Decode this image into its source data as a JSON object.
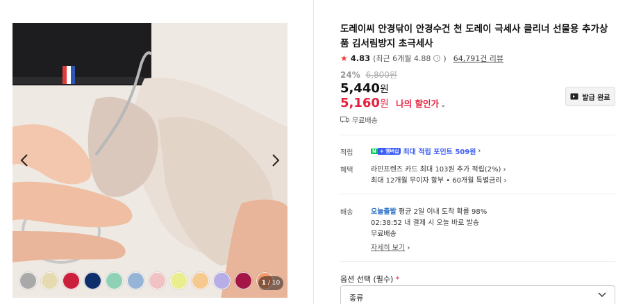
{
  "product": {
    "title": "도레이씨 안경닦이 안경수건 천 도레이 극세사 클리너 선물용 추가상품 김서림방지 초극세사",
    "rating": "4.83",
    "rating_recent": "(최근 6개월 4.88",
    "rating_recent_close": ")",
    "reviews": "64,791건 리뷰",
    "discount_rate": "24%",
    "original_price": "6,800원",
    "sale_price": "5,440",
    "sale_unit": "원",
    "my_price": "5,160",
    "my_unit": "원",
    "my_price_label": "나의 할인가",
    "coupon_button": "발급 완료",
    "free_shipping_label": "무료배송"
  },
  "gallery": {
    "counter_current": "1",
    "counter_total": "/ 10",
    "swatches": [
      "#a9a9a9",
      "#e6dab0",
      "#cc1f3c",
      "#0e2f6c",
      "#8ed1b5",
      "#96b4d6",
      "#f1c2c4",
      "#ebee8f",
      "#f6c98e",
      "#b7aee8",
      "#a31645",
      "#f19a6d"
    ]
  },
  "benefits": {
    "points_label": "적립",
    "npay_n": "N",
    "npay_plus": "+ 멤버십",
    "points_text": "최대 적립 포인트 509원",
    "benefit_label": "혜택",
    "benefit_line1": "라인프렌즈 카드 최대 103원 추가 적립(2%)",
    "benefit_line2": "최대 12개월 무이자 할부 • 60개월 특별금리"
  },
  "delivery": {
    "label": "배송",
    "today": "오늘출발",
    "today_info": "평균 2일 이내 도착 확률 98%",
    "time": "02:38:52",
    "time_info": "내 결제 시 오늘 바로 발송",
    "free": "무료배송",
    "more": "자세히 보기"
  },
  "options": {
    "label": "옵션 선택 (필수)",
    "required_mark": "*",
    "select_value": "종류"
  }
}
